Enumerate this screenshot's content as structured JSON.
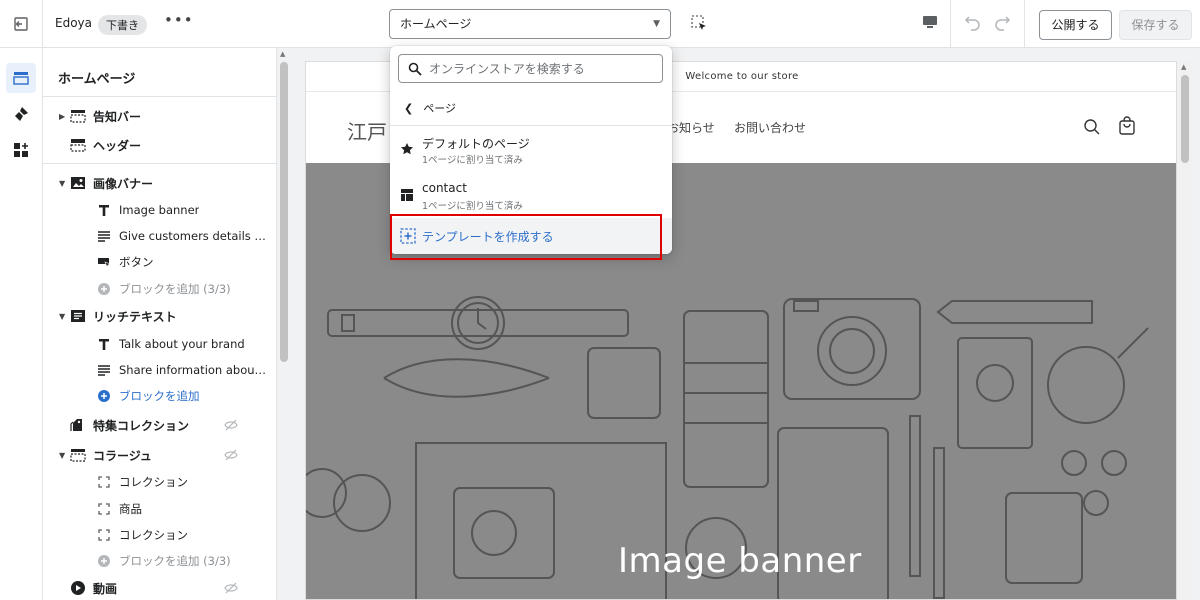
{
  "topbar": {
    "store_name": "Edoya",
    "status_badge": "下書き",
    "more": "•••",
    "page_selector": "ホームページ",
    "publish_label": "公開する",
    "save_label": "保存する"
  },
  "sidebar": {
    "title": "ホームページ",
    "sections": {
      "announcement_bar": "告知バー",
      "header": "ヘッダー",
      "image_banner": "画像バナー",
      "image_banner_blocks": [
        "Image banner",
        "Give customers details abo...",
        "ボタン"
      ],
      "add_block_3_3": "ブロックを追加 (3/3)",
      "rich_text": "リッチテキスト",
      "rich_text_blocks": [
        "Talk about your brand",
        "Share information about yo..."
      ],
      "add_block": "ブロックを追加",
      "featured_collection": "特集コレクション",
      "collage": "コラージュ",
      "collage_blocks": [
        "コレクション",
        "商品",
        "コレクション"
      ],
      "add_block_collage": "ブロックを追加 (3/3)",
      "video": "動画"
    }
  },
  "preview": {
    "announcement": "Welcome to our store",
    "logo": "江戸",
    "nav": [
      "お知らせ",
      "お問い合わせ"
    ],
    "banner_heading": "Image banner"
  },
  "dropdown": {
    "search_placeholder": "オンラインストアを検索する",
    "back_label": "ページ",
    "items": [
      {
        "title": "デフォルトのページ",
        "subtitle": "1ページに割り当て済み",
        "icon": "star-icon"
      },
      {
        "title": "contact",
        "subtitle": "1ページに割り当て済み",
        "icon": "template-layout-icon"
      }
    ],
    "create_label": "テンプレートを作成する"
  },
  "colors": {
    "accent": "#2c6ecb",
    "highlight": "#e00000",
    "banner_bg": "#8a8a8a"
  }
}
